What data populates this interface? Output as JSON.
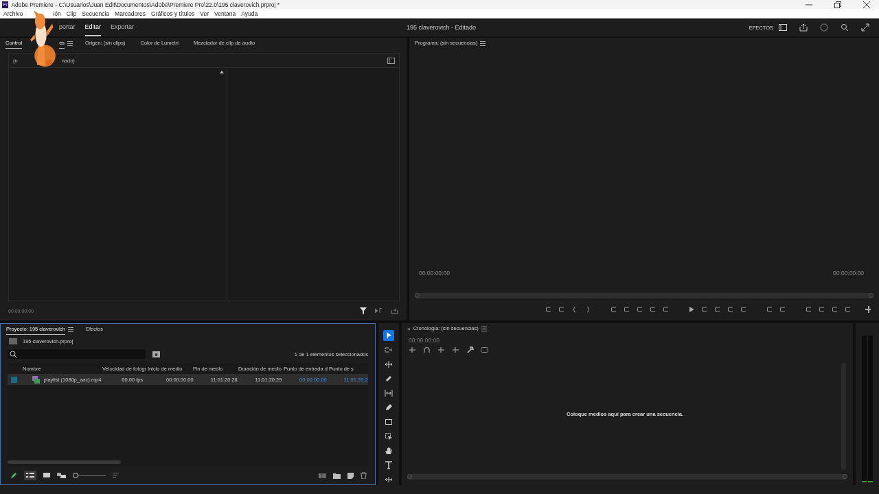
{
  "window": {
    "logo": "Pr",
    "title": "Adobe Premiere - C:\\Usuarios\\Juan Edit\\Documentos\\Adobe\\Premiere Pro\\22.0\\195 claverovich.prproj *"
  },
  "menu": [
    "Archivo",
    "ión",
    "Clip",
    "Secuencia",
    "Marcadores",
    "Gráficos y títulos",
    "Ver",
    "Ventana",
    "Ayuda"
  ],
  "workspaces": [
    {
      "label": "portar",
      "selected": false
    },
    {
      "label": "Editar",
      "selected": true
    },
    {
      "label": "Exportar",
      "selected": false
    }
  ],
  "project_title": "195 claverovich - Editado",
  "effects_label": "EFECTOS",
  "source_panel": {
    "tabs": [
      {
        "label": "Control",
        "tail": "es",
        "selected": true
      },
      {
        "label": "Origen: (sin clips)",
        "selected": false
      },
      {
        "label": "Color de Lumetri",
        "selected": false
      },
      {
        "label": "Mezclador de clip de audio",
        "selected": false
      }
    ],
    "header_left": "(n",
    "header_right": "nado)",
    "timecode": "00:00:00:00"
  },
  "program_panel": {
    "title": "Programa: (sin secuencias)",
    "timecode_left": "00:00:00:00",
    "timecode_right": "00:00:00:00"
  },
  "project_panel": {
    "tabs": [
      {
        "label": "Proyecto: 195 claverovich",
        "selected": true
      },
      {
        "label": "Efectos",
        "selected": false
      }
    ],
    "file": "195 claverovich.prproj",
    "status": "1 de 1 elementos seleccionados",
    "columns": [
      "Nombre",
      "Velocidad de fotogr",
      "Inicio de medio",
      "Fin de medio",
      "Duración de medio",
      "Punto de entrada d",
      "Punto de s"
    ],
    "zoom": {
      "level": 0
    },
    "rows": [
      {
        "selected": true,
        "cells": [
          "playlist (1080p_aac).mp4",
          "60,00 fps",
          "00:00:00:00",
          "11:01:20:28",
          "11:01:20:29",
          "00:00:00:00",
          "11:01:20:2"
        ]
      }
    ]
  },
  "tools": [
    {
      "kind": "select",
      "selected": true
    },
    {
      "kind": "track",
      "selected": false
    },
    {
      "kind": "ripple",
      "selected": false
    },
    {
      "kind": "razor",
      "selected": false
    },
    {
      "kind": "slip",
      "selected": false
    },
    {
      "kind": "pen",
      "selected": false
    },
    {
      "kind": "rect",
      "selected": false
    },
    {
      "kind": "marquee",
      "selected": false
    },
    {
      "kind": "hand",
      "selected": false
    },
    {
      "kind": "type",
      "selected": false
    },
    {
      "kind": "extra",
      "selected": false
    }
  ],
  "timeline": {
    "close": "×",
    "title": "Cronología: (sin secuencias)",
    "timecode": "00:00:00:00",
    "message": "Coloque medios aquí para crear una secuencia."
  }
}
